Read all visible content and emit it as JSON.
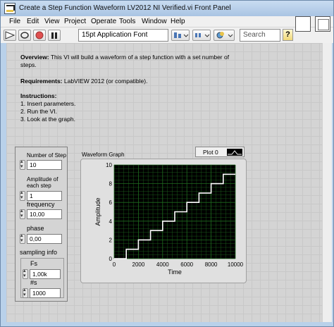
{
  "window": {
    "title": "Create a Step Function Waveform LV2012 NI Verified.vi Front Panel"
  },
  "menu": [
    "File",
    "Edit",
    "View",
    "Project",
    "Operate",
    "Tools",
    "Window",
    "Help"
  ],
  "toolbar": {
    "font": "15pt Application Font",
    "search_placeholder": "Search",
    "help": "?"
  },
  "description": {
    "overview_label": "Overview:",
    "overview_text": " This VI will build a waveform of a step function with a set number of steps.",
    "requirements_label": "Requirements:",
    "requirements_text": " LabVIEW 2012 (or compatible).",
    "instructions_label": "Instructions:",
    "steps": [
      "1.  Insert parameters.",
      "2.  Run the VI.",
      "3. Look at the graph."
    ]
  },
  "controls": {
    "number_of_step_label": "Number of Step",
    "number_of_step_value": "10",
    "amplitude_label_1": "Amplitude of",
    "amplitude_label_2": "each step",
    "amplitude_value": "1",
    "frequency_label": "frequency",
    "frequency_value": "10,00",
    "phase_label": "phase",
    "phase_value": "0,00",
    "sampling_label": "sampling info",
    "fs_label": "Fs",
    "fs_value": "1,00k",
    "ns_label": "#s",
    "ns_value": "1000"
  },
  "graph": {
    "label": "Waveform Graph",
    "legend_name": "Plot 0"
  },
  "chart_data": {
    "type": "line",
    "xlabel": "Time",
    "ylabel": "Amplitude",
    "xlim": [
      0,
      10000
    ],
    "ylim": [
      0,
      10
    ],
    "xticks": [
      0,
      2000,
      4000,
      6000,
      8000,
      10000
    ],
    "yticks": [
      0,
      2,
      4,
      6,
      8,
      10
    ],
    "grid": true,
    "series": [
      {
        "x": [
          0,
          1000,
          1000,
          2000,
          2000,
          3000,
          3000,
          4000,
          4000,
          5000,
          5000,
          6000,
          6000,
          7000,
          7000,
          8000,
          8000,
          9000,
          9000,
          10000
        ],
        "y": [
          0,
          0,
          1,
          1,
          2,
          2,
          3,
          3,
          4,
          4,
          5,
          5,
          6,
          6,
          7,
          7,
          8,
          8,
          9,
          9
        ]
      }
    ],
    "colors": {
      "plot_bg": "#000000",
      "grid": "#1f6b1f",
      "line": "#ffffff"
    }
  }
}
